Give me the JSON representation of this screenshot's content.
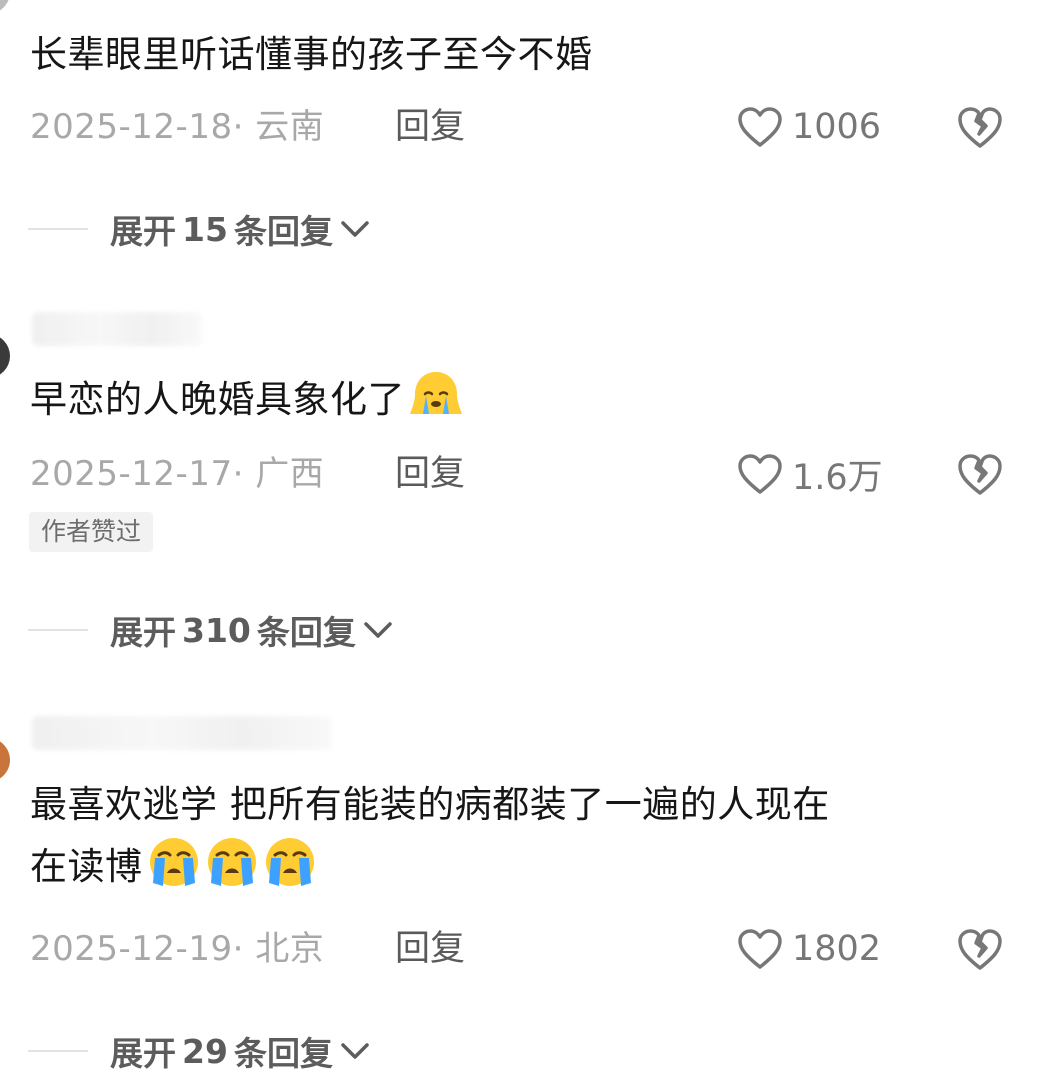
{
  "comments": [
    {
      "text": "长辈眼里听话懂事的孩子至今不婚",
      "date_location": "2025-12-18· 云南",
      "reply_label": "回复",
      "likes": "1006",
      "expand": {
        "prefix": "展开",
        "count": "15",
        "suffix": "条回复"
      }
    },
    {
      "text": "早恋的人晚婚具象化了",
      "emoji": [
        "crying-face"
      ],
      "date_location": "2025-12-17· 广西",
      "reply_label": "回复",
      "likes": "1.6万",
      "badge": "作者赞过",
      "expand": {
        "prefix": "展开",
        "count": "310",
        "suffix": "条回复"
      }
    },
    {
      "text_line1": "最喜欢逃学 把所有能装的病都装了一遍的人现在",
      "text_line2": "在读博",
      "emoji": [
        "loudly-crying-face",
        "loudly-crying-face",
        "loudly-crying-face"
      ],
      "date_location": "2025-12-19· 北京",
      "reply_label": "回复",
      "likes": "1802",
      "expand": {
        "prefix": "展开",
        "count": "29",
        "suffix": "条回复"
      }
    }
  ],
  "colors": {
    "secondary_text": "#a8a8a8",
    "primary_text": "#161616",
    "icon_gray": "#777777",
    "badge_bg": "#f2f2f2"
  },
  "icons": {
    "like": "heart-outline-icon",
    "dislike": "broken-heart-icon",
    "expand": "chevron-down-icon"
  }
}
